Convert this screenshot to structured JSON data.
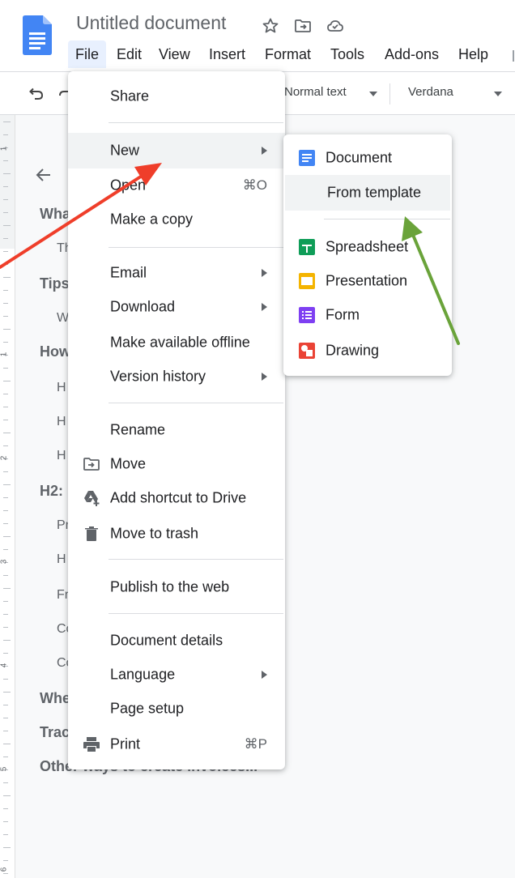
{
  "header": {
    "title": "Untitled document",
    "title_icons": [
      "star-icon",
      "move-folder-icon",
      "cloud-saved-icon"
    ]
  },
  "menubar": {
    "items": [
      "File",
      "Edit",
      "View",
      "Insert",
      "Format",
      "Tools",
      "Add-ons",
      "Help"
    ],
    "active": "File"
  },
  "toolbar": {
    "style_value": "Normal text",
    "font_value": "Verdana"
  },
  "ruler": {
    "numbers": [
      "1",
      "1",
      "2",
      "3",
      "4",
      "5",
      "6"
    ]
  },
  "outline": {
    "headings": [
      "Wha",
      "Tips",
      "How",
      "H2:",
      "Whe",
      "Trac",
      "Other ways to create invoices..."
    ],
    "subitems": [
      "Th",
      "W",
      "H",
      "H",
      "H",
      "Pr",
      "H",
      "Fr",
      "Co",
      "Co"
    ]
  },
  "file_menu": {
    "share": "Share",
    "new": "New",
    "open": "Open",
    "open_shortcut": "⌘O",
    "make_copy": "Make a copy",
    "email": "Email",
    "download": "Download",
    "offline": "Make available offline",
    "version_history": "Version history",
    "rename": "Rename",
    "move": "Move",
    "add_shortcut": "Add shortcut to Drive",
    "trash": "Move to trash",
    "publish": "Publish to the web",
    "details": "Document details",
    "language": "Language",
    "page_setup": "Page setup",
    "print": "Print",
    "print_shortcut": "⌘P"
  },
  "new_submenu": {
    "document": "Document",
    "from_template": "From template",
    "spreadsheet": "Spreadsheet",
    "presentation": "Presentation",
    "form": "Form",
    "drawing": "Drawing"
  },
  "colors": {
    "docs_blue": "#4285f4",
    "sheets_green": "#0f9d58",
    "slides_yellow": "#f4b400",
    "forms_purple": "#7e3ff2",
    "drawing_red": "#ea4335",
    "red_arrow": "#ef3e2a",
    "green_arrow": "#6aa33a",
    "menu_active_bg": "#e8f0fe",
    "hover_bg": "#f1f3f4"
  }
}
